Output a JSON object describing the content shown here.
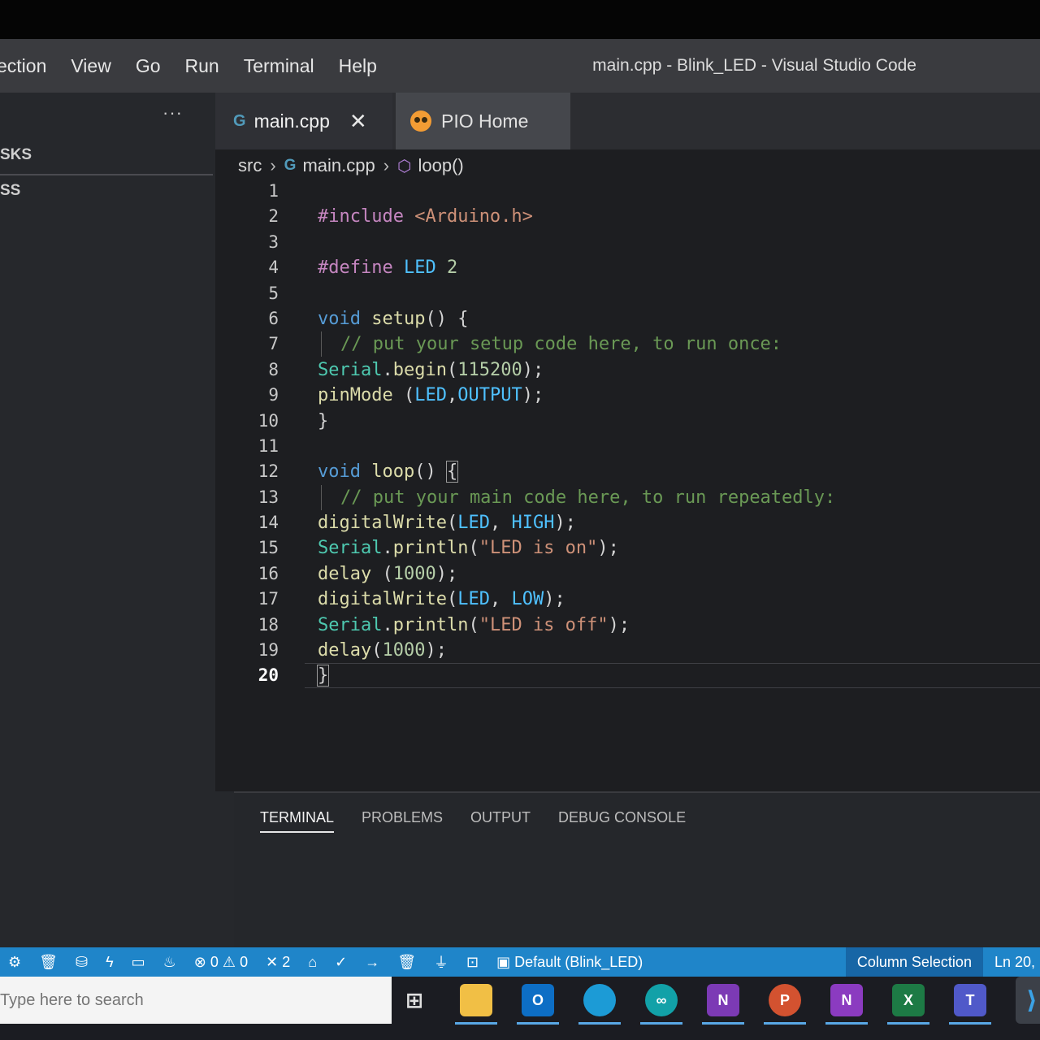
{
  "menubar": {
    "items": [
      "ection",
      "View",
      "Go",
      "Run",
      "Terminal",
      "Help"
    ],
    "window_title": "main.cpp - Blink_LED - Visual Studio Code"
  },
  "sidebar": {
    "more": "···",
    "section1": "SKS",
    "section2": "SS"
  },
  "tabs": [
    {
      "label": "main.cpp",
      "icon": "cpp-file-icon",
      "close": "✕"
    },
    {
      "label": "PIO Home",
      "icon": "platformio-icon"
    }
  ],
  "breadcrumb": {
    "folder": "src",
    "file": "main.cpp",
    "symbol": "loop()"
  },
  "code": {
    "lines": [
      {
        "n": "1"
      },
      {
        "n": "2"
      },
      {
        "n": "3"
      },
      {
        "n": "4"
      },
      {
        "n": "5"
      },
      {
        "n": "6"
      },
      {
        "n": "7"
      },
      {
        "n": "8"
      },
      {
        "n": "9"
      },
      {
        "n": "10"
      },
      {
        "n": "11"
      },
      {
        "n": "12"
      },
      {
        "n": "13"
      },
      {
        "n": "14"
      },
      {
        "n": "15"
      },
      {
        "n": "16"
      },
      {
        "n": "17"
      },
      {
        "n": "18"
      },
      {
        "n": "19"
      },
      {
        "n": "20"
      }
    ],
    "tokens": {
      "include_kw": "#include",
      "include_val": "<Arduino.h>",
      "define_kw": "#define",
      "define_name": "LED",
      "define_val": "2",
      "void": "void",
      "setup": "setup",
      "loop": "loop",
      "setup_comment": "// put your setup code here, to run once:",
      "loop_comment": "// put your main code here, to run repeatedly:",
      "serial": "Serial",
      "begin": "begin",
      "baud": "115200",
      "pinMode": "pinMode",
      "led": "LED",
      "output": "OUTPUT",
      "digitalWrite": "digitalWrite",
      "high": "HIGH",
      "low": "LOW",
      "println": "println",
      "str_on": "\"LED is on\"",
      "str_off": "\"LED is off\"",
      "delay": "delay",
      "ms": "1000"
    }
  },
  "panel": {
    "tabs": [
      "TERMINAL",
      "PROBLEMS",
      "OUTPUT",
      "DEBUG CONSOLE"
    ]
  },
  "statusbar": {
    "errors": "0",
    "warnings": "0",
    "tasks": "2",
    "env": "Default (Blink_LED)",
    "selection_mode": "Column Selection",
    "position": "Ln 20,"
  },
  "taskbar": {
    "search_placeholder": "Type here to search",
    "outlook_letter": "O",
    "onenote_letter": "N",
    "ppt_letter": "P",
    "onenote2_letter": "N",
    "excel_letter": "X",
    "teams_letter": "T",
    "vscode_glyph": "⟩"
  }
}
